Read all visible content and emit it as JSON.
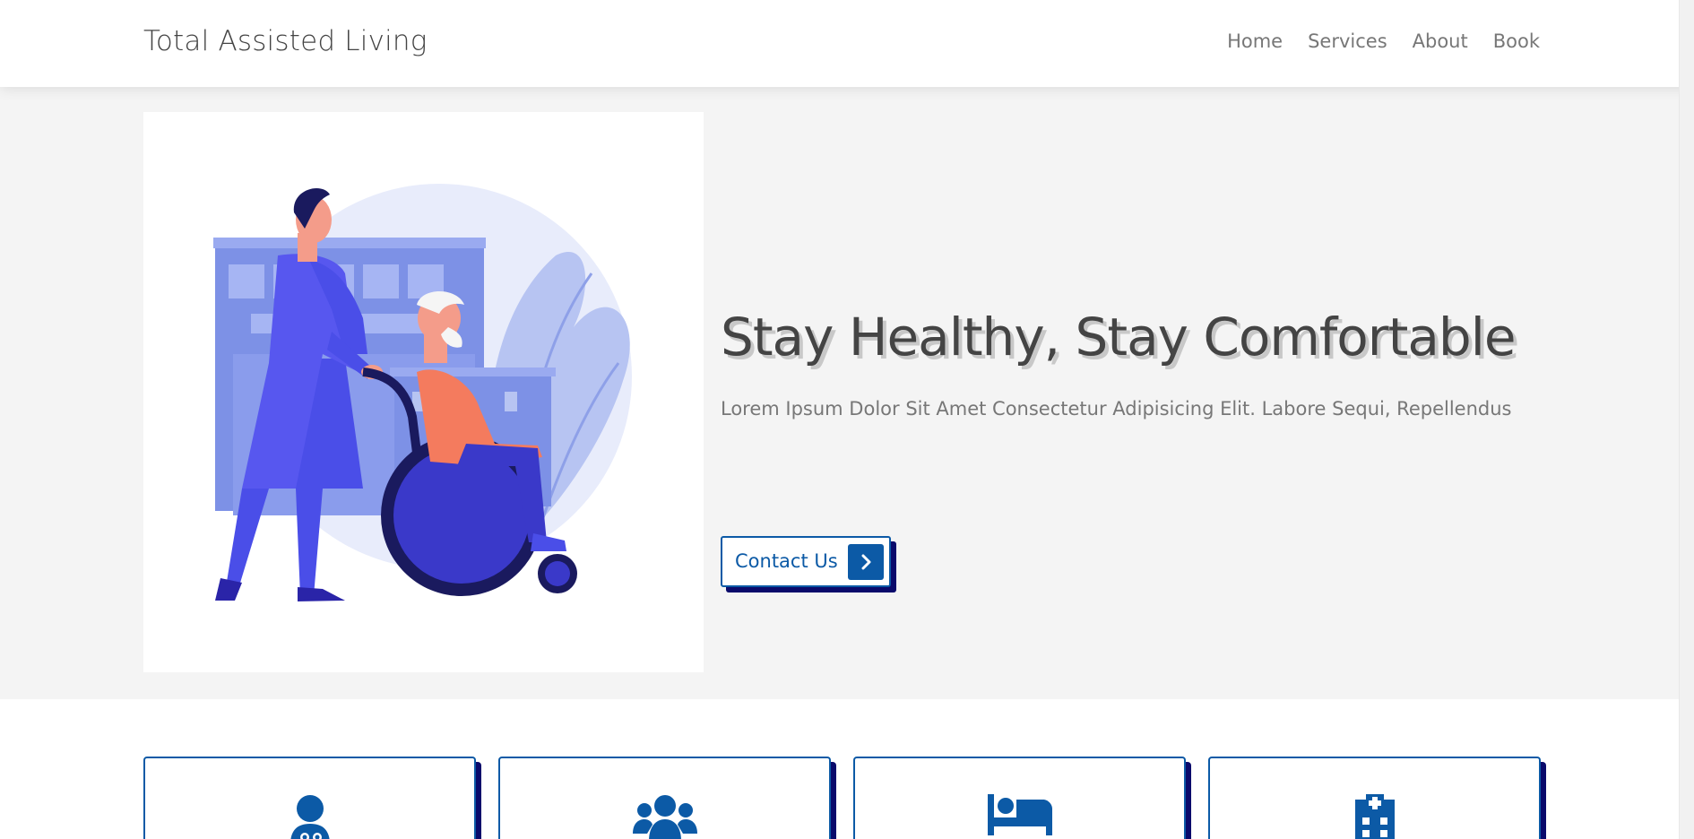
{
  "header": {
    "logo": "Total Assisted Living",
    "nav": [
      {
        "label": "Home"
      },
      {
        "label": "Services"
      },
      {
        "label": "About"
      },
      {
        "label": "Book"
      }
    ]
  },
  "hero": {
    "headline": "Stay Healthy, Stay Comfortable",
    "subtitle": "Lorem Ipsum Dolor Sit Amet Consectetur Adipisicing Elit. Labore Sequi, Repellendus",
    "cta_label": "Contact Us",
    "cta_icon": "chevron-right-icon",
    "illustration": "caregiver-pushing-wheelchair-illustration"
  },
  "services": {
    "cards": [
      {
        "icon": "doctor-icon"
      },
      {
        "icon": "users-icon"
      },
      {
        "icon": "bed-icon"
      },
      {
        "icon": "hospital-icon"
      }
    ]
  },
  "colors": {
    "accent": "#0c5aa6",
    "shadow": "#0a0a6b",
    "text": "#444444",
    "muted": "#777777",
    "hero_bg": "#f4f4f4",
    "illustration_primary": "#4a4ee8",
    "illustration_accent": "#f47b5e"
  }
}
